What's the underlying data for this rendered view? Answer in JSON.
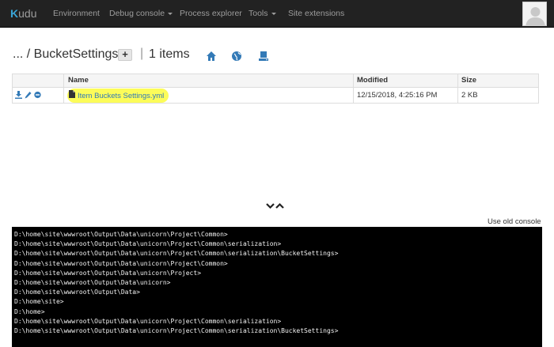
{
  "navbar": {
    "brand_prefix": "K",
    "brand_rest": "udu",
    "items": [
      {
        "label": "Environment"
      },
      {
        "label": "Debug console",
        "dropdown": true
      },
      {
        "label": "Process explorer"
      },
      {
        "label": "Tools",
        "dropdown": true
      },
      {
        "label": "Site extensions"
      }
    ]
  },
  "breadcrumb": {
    "path": "... / BucketSettings",
    "add_label": "+",
    "separator": "|",
    "item_count": "1 items",
    "icons": [
      "home-icon",
      "globe-icon",
      "drive-icon"
    ]
  },
  "file_table": {
    "columns": [
      "Name",
      "Modified",
      "Size"
    ],
    "rows": [
      {
        "name": "Item Buckets Settings.yml",
        "modified": "12/15/2018, 4:25:16 PM",
        "size": "2 KB"
      }
    ],
    "row_icons": [
      "download-icon",
      "edit-icon",
      "delete-icon",
      "file-icon"
    ]
  },
  "console": {
    "use_old_console_label": "Use old console",
    "lines": [
      "D:\\home\\site\\wwwroot\\Output\\Data\\unicorn\\Project\\Common>",
      "D:\\home\\site\\wwwroot\\Output\\Data\\unicorn\\Project\\Common\\serialization>",
      "D:\\home\\site\\wwwroot\\Output\\Data\\unicorn\\Project\\Common\\serialization\\BucketSettings>",
      "D:\\home\\site\\wwwroot\\Output\\Data\\unicorn\\Project\\Common>",
      "D:\\home\\site\\wwwroot\\Output\\Data\\unicorn\\Project>",
      "D:\\home\\site\\wwwroot\\Output\\Data\\unicorn>",
      "D:\\home\\site\\wwwroot\\Output\\Data>",
      "D:\\home\\site>",
      "D:\\home>",
      "D:\\home\\site\\wwwroot\\Output\\Data\\unicorn\\Project\\Common\\serialization>",
      "D:\\home\\site\\wwwroot\\Output\\Data\\unicorn\\Project\\Common\\serialization\\BucketSettings>"
    ]
  },
  "colors": {
    "navbar_bg": "#222222",
    "navbar_text": "#9d9d9d",
    "brand_accent": "#3aa6d8",
    "link": "#337ab7",
    "highlight": "#fbfb3c",
    "console_bg": "#000000",
    "console_text": "#f2f2f2"
  }
}
